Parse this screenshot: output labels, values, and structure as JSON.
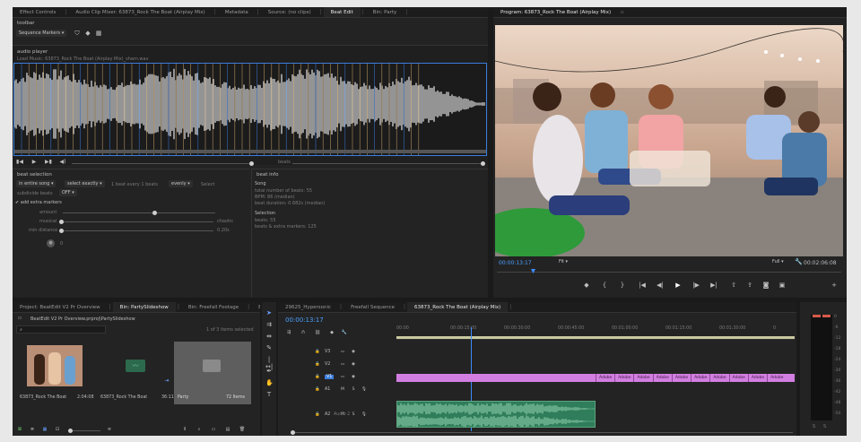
{
  "beat_edit": {
    "tabs": [
      {
        "label": "Effect Controls",
        "active": false
      },
      {
        "label": "Audio Clip Mixer: 63873_Rock The Boat (Airplay Mix)",
        "active": false
      },
      {
        "label": "Metadata",
        "active": false
      },
      {
        "label": "Source: (no clips)",
        "active": false
      },
      {
        "label": "Beat Edit",
        "active": true
      },
      {
        "label": "Bin: Party",
        "active": false
      }
    ],
    "toolbar_label": "toolbar",
    "sequence_markers": "Sequence Markers",
    "audio_player_label": "audio player",
    "load_music": "Load Music:  63873_Rock The Boat (Airplay Mix)_sham.wav",
    "beats_label": "beats",
    "beat_selection": {
      "title": "beat selection",
      "scope": "in entire song",
      "mode": "select exactly",
      "count_text": "1 beat every  1  beats",
      "evenly": "evenly",
      "select_button": "Select",
      "subdivide_label": "subdivide beats",
      "subdivide_value": "OFF",
      "add_extra_label": "add extra markers",
      "amount_label": "amount",
      "musical_label": "musical",
      "chaotic_label": "chaotic",
      "min_distance_label": "min distance",
      "min_distance_value": "0.20s",
      "zero_value": "0"
    },
    "beat_info": {
      "title": "beat info",
      "song_heading": "Song",
      "total_beats": "total number of beats: 55",
      "bpm": "BPM: 86 (median)",
      "beat_duration": "beat duration: 0.682s (median)",
      "selection_heading": "Selection",
      "beats": "beats: 55",
      "beats_extra": "beats & extra markers: 125"
    }
  },
  "program": {
    "title": "Program: 63873_Rock The Boat (Airplay Mix)",
    "timecode": "00:00:13:17",
    "fit": "Fit",
    "quality": "Full",
    "duration": "00:02:06:08"
  },
  "project": {
    "tabs": [
      {
        "label": "Project: BeatEdit V2 Pr Overview",
        "active": false
      },
      {
        "label": "Bin: PartySlideshow",
        "active": true
      },
      {
        "label": "Bin: Freefall Footage",
        "active": false
      },
      {
        "label": "Bin: Be",
        "active": false
      }
    ],
    "path": "BeatEdit V2 Pr Overview.prproj\\PartySlideshow",
    "items_selected": "1 of 3 items selected",
    "items": [
      {
        "name": "63873_Rock The Boat",
        "duration": "2:04:08"
      },
      {
        "name": "63873_Rock The Boat",
        "duration": "36:11"
      },
      {
        "name": "Party",
        "duration": "72 Items"
      }
    ]
  },
  "timeline": {
    "tabs": [
      {
        "label": "29625_Hypersonic",
        "active": false
      },
      {
        "label": "Freefall Sequence",
        "active": false
      },
      {
        "label": "63873_Rock The Boat (Airplay Mix)",
        "active": true
      }
    ],
    "timecode": "00:00:13:17",
    "ruler": [
      "00:00",
      "00:00:15:00",
      "00:00:30:00",
      "00:00:45:00",
      "00:01:00:00",
      "00:01:15:00",
      "00:01:30:00",
      "0"
    ],
    "video_tracks": [
      "V3",
      "V2",
      "V1"
    ],
    "audio_tracks": [
      "A1",
      "A2"
    ],
    "audio2_name": "Audio 2",
    "clip_label": "Adobe",
    "meter_scale": [
      "0",
      "-6",
      "-12",
      "-18",
      "-24",
      "-30",
      "-36",
      "-42",
      "-48",
      "-54"
    ],
    "meter_bottom": [
      "S",
      "S"
    ]
  },
  "colors": {
    "accent": "#3b7ddd",
    "clip_video": "#d27ee0",
    "clip_audio": "#2f7d5a",
    "playhead": "#3d8cff"
  }
}
